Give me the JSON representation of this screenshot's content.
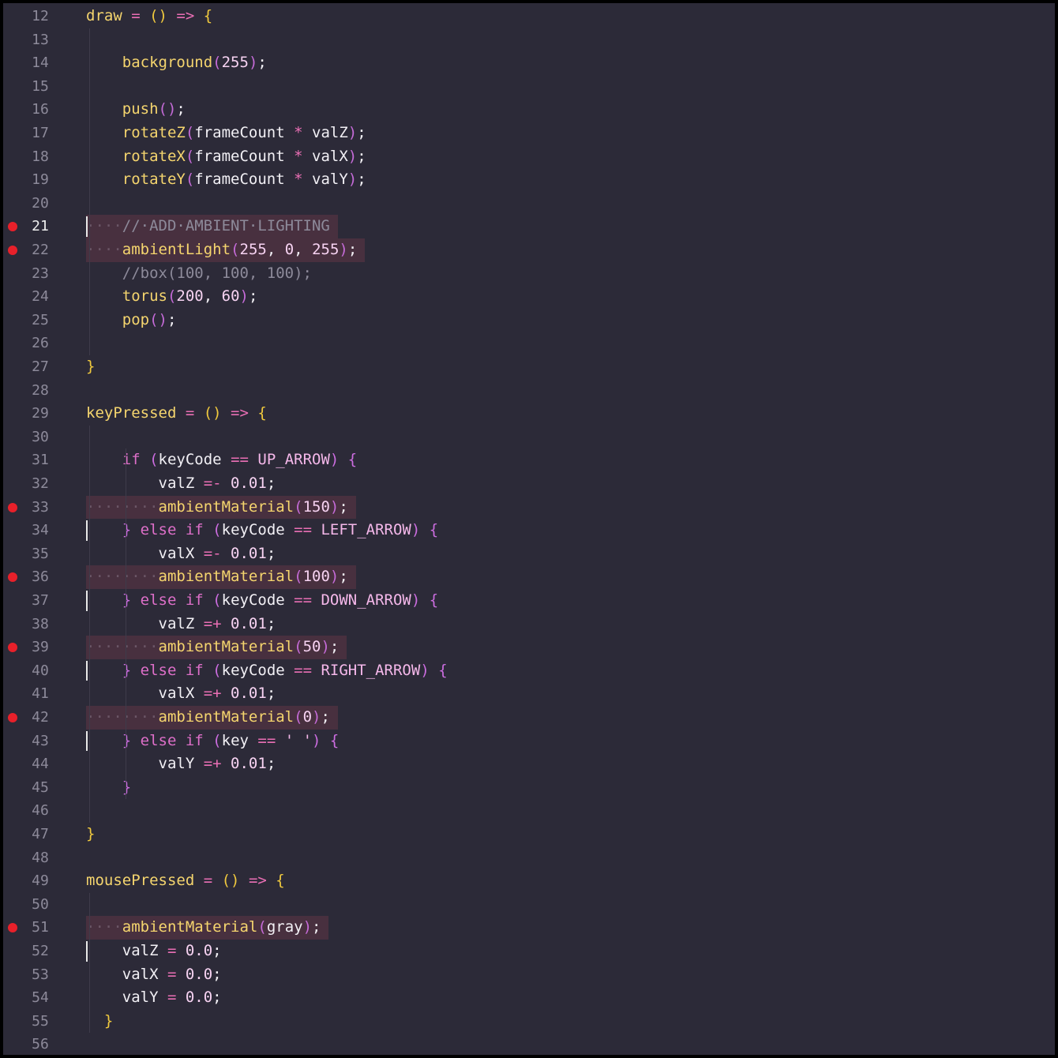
{
  "editor": {
    "lines": [
      {
        "n": "12",
        "bp": false,
        "hl": false,
        "tokens": [
          [
            "fn",
            "draw"
          ],
          [
            "op",
            " = "
          ],
          [
            "yb",
            "()"
          ],
          [
            "op",
            " => "
          ],
          [
            "yb",
            "{"
          ]
        ]
      },
      {
        "n": "13",
        "bp": false,
        "hl": false,
        "tokens": []
      },
      {
        "n": "14",
        "bp": false,
        "hl": false,
        "tokens": [
          [
            "id",
            "    "
          ],
          [
            "fn",
            "background"
          ],
          [
            "pu",
            "("
          ],
          [
            "num",
            "255"
          ],
          [
            "pu",
            ")"
          ],
          [
            "id",
            ";"
          ]
        ]
      },
      {
        "n": "15",
        "bp": false,
        "hl": false,
        "tokens": []
      },
      {
        "n": "16",
        "bp": false,
        "hl": false,
        "tokens": [
          [
            "id",
            "    "
          ],
          [
            "fn",
            "push"
          ],
          [
            "pu",
            "()"
          ],
          [
            "id",
            ";"
          ]
        ]
      },
      {
        "n": "17",
        "bp": false,
        "hl": false,
        "tokens": [
          [
            "id",
            "    "
          ],
          [
            "fn",
            "rotateZ"
          ],
          [
            "pu",
            "("
          ],
          [
            "id",
            "frameCount "
          ],
          [
            "op",
            "*"
          ],
          [
            "id",
            " valZ"
          ],
          [
            "pu",
            ")"
          ],
          [
            "id",
            ";"
          ]
        ]
      },
      {
        "n": "18",
        "bp": false,
        "hl": false,
        "tokens": [
          [
            "id",
            "    "
          ],
          [
            "fn",
            "rotateX"
          ],
          [
            "pu",
            "("
          ],
          [
            "id",
            "frameCount "
          ],
          [
            "op",
            "*"
          ],
          [
            "id",
            " valX"
          ],
          [
            "pu",
            ")"
          ],
          [
            "id",
            ";"
          ]
        ]
      },
      {
        "n": "19",
        "bp": false,
        "hl": false,
        "tokens": [
          [
            "id",
            "    "
          ],
          [
            "fn",
            "rotateY"
          ],
          [
            "pu",
            "("
          ],
          [
            "id",
            "frameCount "
          ],
          [
            "op",
            "*"
          ],
          [
            "id",
            " valY"
          ],
          [
            "pu",
            ")"
          ],
          [
            "id",
            ";"
          ]
        ]
      },
      {
        "n": "20",
        "bp": false,
        "hl": false,
        "tokens": []
      },
      {
        "n": "21",
        "bp": true,
        "hl": true,
        "cur": true,
        "tokens": [
          [
            "ws",
            "····"
          ],
          [
            "cm",
            "//·ADD·AMBIENT·LIGHTING"
          ]
        ]
      },
      {
        "n": "22",
        "bp": true,
        "hl": true,
        "tokens": [
          [
            "ws",
            "····"
          ],
          [
            "fn",
            "ambientLight"
          ],
          [
            "pu",
            "("
          ],
          [
            "num",
            "255"
          ],
          [
            "id",
            ", "
          ],
          [
            "num",
            "0"
          ],
          [
            "id",
            ", "
          ],
          [
            "num",
            "255"
          ],
          [
            "pu",
            ")"
          ],
          [
            "id",
            ";"
          ]
        ]
      },
      {
        "n": "23",
        "bp": false,
        "hl": false,
        "tokens": [
          [
            "id",
            "    "
          ],
          [
            "cm",
            "//box(100, 100, 100);"
          ]
        ]
      },
      {
        "n": "24",
        "bp": false,
        "hl": false,
        "tokens": [
          [
            "id",
            "    "
          ],
          [
            "fn",
            "torus"
          ],
          [
            "pu",
            "("
          ],
          [
            "num",
            "200"
          ],
          [
            "id",
            ", "
          ],
          [
            "num",
            "60"
          ],
          [
            "pu",
            ")"
          ],
          [
            "id",
            ";"
          ]
        ]
      },
      {
        "n": "25",
        "bp": false,
        "hl": false,
        "tokens": [
          [
            "id",
            "    "
          ],
          [
            "fn",
            "pop"
          ],
          [
            "pu",
            "()"
          ],
          [
            "id",
            ";"
          ]
        ]
      },
      {
        "n": "26",
        "bp": false,
        "hl": false,
        "tokens": []
      },
      {
        "n": "27",
        "bp": false,
        "hl": false,
        "tokens": [
          [
            "yb",
            "}"
          ]
        ]
      },
      {
        "n": "28",
        "bp": false,
        "hl": false,
        "tokens": []
      },
      {
        "n": "29",
        "bp": false,
        "hl": false,
        "tokens": [
          [
            "fn",
            "keyPressed"
          ],
          [
            "op",
            " = "
          ],
          [
            "yb",
            "()"
          ],
          [
            "op",
            " => "
          ],
          [
            "yb",
            "{"
          ]
        ]
      },
      {
        "n": "30",
        "bp": false,
        "hl": false,
        "tokens": []
      },
      {
        "n": "31",
        "bp": false,
        "hl": false,
        "tokens": [
          [
            "id",
            "    "
          ],
          [
            "kw",
            "if "
          ],
          [
            "pb",
            "("
          ],
          [
            "id",
            "keyCode "
          ],
          [
            "op",
            "=="
          ],
          [
            "co",
            " UP_ARROW"
          ],
          [
            "pb",
            ") {"
          ]
        ]
      },
      {
        "n": "32",
        "bp": false,
        "hl": false,
        "tokens": [
          [
            "id",
            "        valZ "
          ],
          [
            "op",
            "=-"
          ],
          [
            "num",
            " 0.01"
          ],
          [
            "id",
            ";"
          ]
        ]
      },
      {
        "n": "33",
        "bp": true,
        "hl": true,
        "tokens": [
          [
            "ws",
            "········"
          ],
          [
            "fn",
            "ambientMaterial"
          ],
          [
            "pu",
            "("
          ],
          [
            "num",
            "150"
          ],
          [
            "pu",
            ")"
          ],
          [
            "id",
            ";"
          ]
        ]
      },
      {
        "n": "34",
        "bp": false,
        "hl": false,
        "tokens": [
          [
            "id",
            "    "
          ],
          [
            "pb",
            "} "
          ],
          [
            "kw",
            "else if "
          ],
          [
            "pb",
            "("
          ],
          [
            "id",
            "keyCode "
          ],
          [
            "op",
            "=="
          ],
          [
            "co",
            " LEFT_ARROW"
          ],
          [
            "pb",
            ") {"
          ]
        ]
      },
      {
        "n": "35",
        "bp": false,
        "hl": false,
        "tokens": [
          [
            "id",
            "        valX "
          ],
          [
            "op",
            "=-"
          ],
          [
            "num",
            " 0.01"
          ],
          [
            "id",
            ";"
          ]
        ]
      },
      {
        "n": "36",
        "bp": true,
        "hl": true,
        "tokens": [
          [
            "ws",
            "········"
          ],
          [
            "fn",
            "ambientMaterial"
          ],
          [
            "pu",
            "("
          ],
          [
            "num",
            "100"
          ],
          [
            "pu",
            ")"
          ],
          [
            "id",
            ";"
          ]
        ]
      },
      {
        "n": "37",
        "bp": false,
        "hl": false,
        "tokens": [
          [
            "id",
            "    "
          ],
          [
            "pb",
            "} "
          ],
          [
            "kw",
            "else if "
          ],
          [
            "pb",
            "("
          ],
          [
            "id",
            "keyCode "
          ],
          [
            "op",
            "=="
          ],
          [
            "co",
            " DOWN_ARROW"
          ],
          [
            "pb",
            ") {"
          ]
        ]
      },
      {
        "n": "38",
        "bp": false,
        "hl": false,
        "tokens": [
          [
            "id",
            "        valZ "
          ],
          [
            "op",
            "=+"
          ],
          [
            "num",
            " 0.01"
          ],
          [
            "id",
            ";"
          ]
        ]
      },
      {
        "n": "39",
        "bp": true,
        "hl": true,
        "tokens": [
          [
            "ws",
            "········"
          ],
          [
            "fn",
            "ambientMaterial"
          ],
          [
            "pu",
            "("
          ],
          [
            "num",
            "50"
          ],
          [
            "pu",
            ")"
          ],
          [
            "id",
            ";"
          ]
        ]
      },
      {
        "n": "40",
        "bp": false,
        "hl": false,
        "tokens": [
          [
            "id",
            "    "
          ],
          [
            "pb",
            "} "
          ],
          [
            "kw",
            "else if "
          ],
          [
            "pb",
            "("
          ],
          [
            "id",
            "keyCode "
          ],
          [
            "op",
            "=="
          ],
          [
            "co",
            " RIGHT_ARROW"
          ],
          [
            "pb",
            ") {"
          ]
        ]
      },
      {
        "n": "41",
        "bp": false,
        "hl": false,
        "tokens": [
          [
            "id",
            "        valX "
          ],
          [
            "op",
            "=+"
          ],
          [
            "num",
            " 0.01"
          ],
          [
            "id",
            ";"
          ]
        ]
      },
      {
        "n": "42",
        "bp": true,
        "hl": true,
        "tokens": [
          [
            "ws",
            "········"
          ],
          [
            "fn",
            "ambientMaterial"
          ],
          [
            "pu",
            "("
          ],
          [
            "num",
            "0"
          ],
          [
            "pu",
            ")"
          ],
          [
            "id",
            ";"
          ]
        ]
      },
      {
        "n": "43",
        "bp": false,
        "hl": false,
        "tokens": [
          [
            "id",
            "    "
          ],
          [
            "pb",
            "} "
          ],
          [
            "kw",
            "else if "
          ],
          [
            "pb",
            "("
          ],
          [
            "id",
            "key "
          ],
          [
            "op",
            "=="
          ],
          [
            "co",
            " ' '"
          ],
          [
            "pb",
            ") {"
          ]
        ]
      },
      {
        "n": "44",
        "bp": false,
        "hl": false,
        "tokens": [
          [
            "id",
            "        valY "
          ],
          [
            "op",
            "=+"
          ],
          [
            "num",
            " 0.01"
          ],
          [
            "id",
            ";"
          ]
        ]
      },
      {
        "n": "45",
        "bp": false,
        "hl": false,
        "tokens": [
          [
            "id",
            "    "
          ],
          [
            "pb",
            "}"
          ]
        ]
      },
      {
        "n": "46",
        "bp": false,
        "hl": false,
        "tokens": []
      },
      {
        "n": "47",
        "bp": false,
        "hl": false,
        "tokens": [
          [
            "yb",
            "}"
          ]
        ]
      },
      {
        "n": "48",
        "bp": false,
        "hl": false,
        "tokens": []
      },
      {
        "n": "49",
        "bp": false,
        "hl": false,
        "tokens": [
          [
            "fn",
            "mousePressed"
          ],
          [
            "op",
            " = "
          ],
          [
            "yb",
            "()"
          ],
          [
            "op",
            " => "
          ],
          [
            "yb",
            "{"
          ]
        ]
      },
      {
        "n": "50",
        "bp": false,
        "hl": false,
        "tokens": []
      },
      {
        "n": "51",
        "bp": true,
        "hl": true,
        "tokens": [
          [
            "ws",
            "····"
          ],
          [
            "fn",
            "ambientMaterial"
          ],
          [
            "pu",
            "("
          ],
          [
            "id",
            "gray"
          ],
          [
            "pu",
            ")"
          ],
          [
            "id",
            ";"
          ]
        ]
      },
      {
        "n": "52",
        "bp": false,
        "hl": false,
        "tokens": [
          [
            "id",
            "    valZ "
          ],
          [
            "op",
            "="
          ],
          [
            "num",
            " 0.0"
          ],
          [
            "id",
            ";"
          ]
        ]
      },
      {
        "n": "53",
        "bp": false,
        "hl": false,
        "tokens": [
          [
            "id",
            "    valX "
          ],
          [
            "op",
            "="
          ],
          [
            "num",
            " 0.0"
          ],
          [
            "id",
            ";"
          ]
        ]
      },
      {
        "n": "54",
        "bp": false,
        "hl": false,
        "tokens": [
          [
            "id",
            "    valY "
          ],
          [
            "op",
            "="
          ],
          [
            "num",
            " 0.0"
          ],
          [
            "id",
            ";"
          ]
        ]
      },
      {
        "n": "55",
        "bp": false,
        "hl": false,
        "tokens": [
          [
            "id",
            "  "
          ],
          [
            "yb",
            "}"
          ]
        ]
      },
      {
        "n": "56",
        "bp": false,
        "hl": false,
        "tokens": []
      }
    ]
  },
  "colors": {
    "background": "#2c2a38",
    "breakpoint": "#e8202a",
    "highlight": "#48303f"
  }
}
